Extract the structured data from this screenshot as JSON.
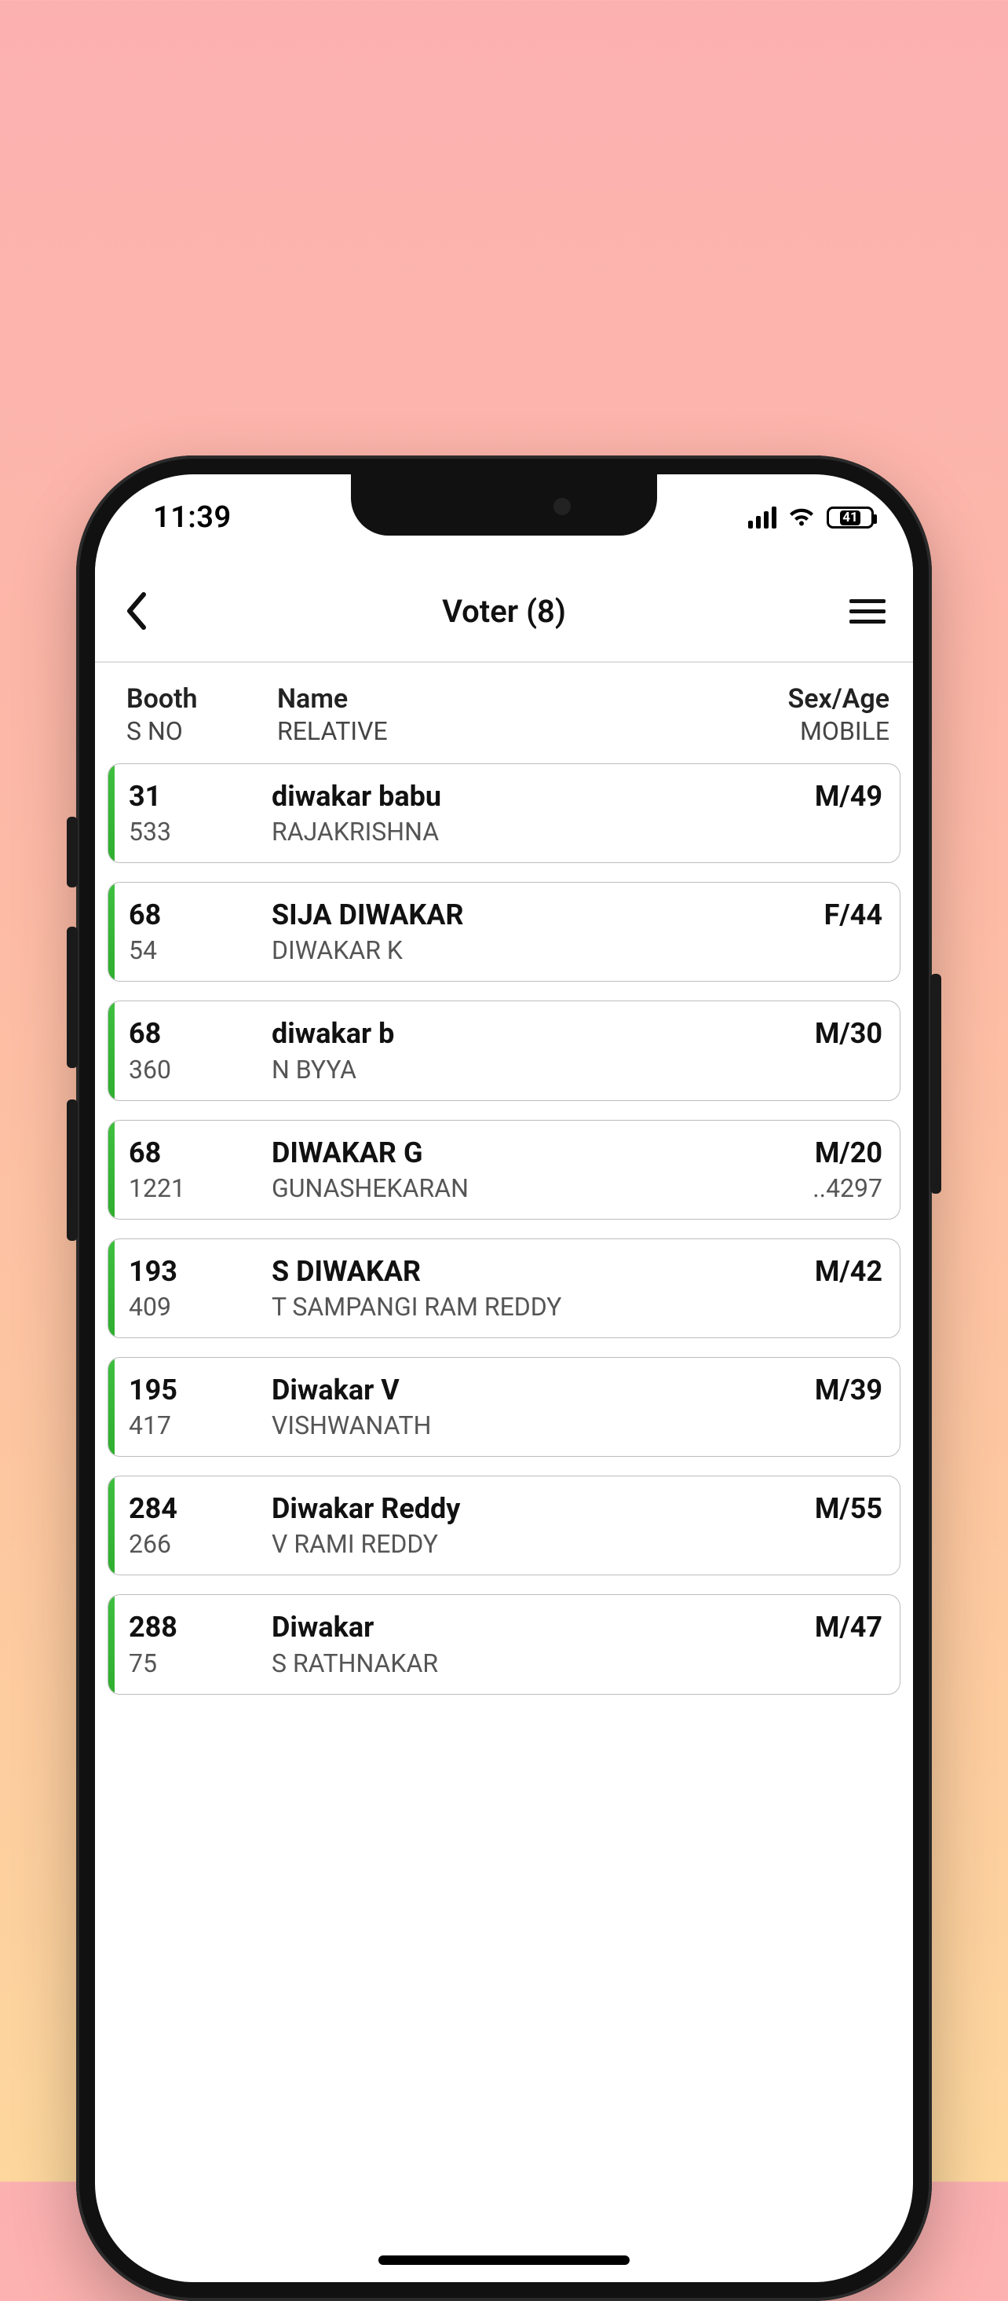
{
  "status": {
    "time": "11:39",
    "battery": "41"
  },
  "header": {
    "title": "Voter (8)"
  },
  "columns": {
    "booth_label": "Booth",
    "sno_label": "S NO",
    "name_label": "Name",
    "relative_label": "RELATIVE",
    "sex_age_label": "Sex/Age",
    "mobile_label": "MOBILE"
  },
  "rows": [
    {
      "booth": "31",
      "sno": "533",
      "name": "diwakar babu",
      "relative": "RAJAKRISHNA",
      "sex_age": "M/49",
      "mobile": ""
    },
    {
      "booth": "68",
      "sno": "54",
      "name": "SIJA DIWAKAR",
      "relative": "DIWAKAR K",
      "sex_age": "F/44",
      "mobile": ""
    },
    {
      "booth": "68",
      "sno": "360",
      "name": "diwakar b",
      "relative": "N BYYA",
      "sex_age": "M/30",
      "mobile": ""
    },
    {
      "booth": "68",
      "sno": "1221",
      "name": "DIWAKAR G",
      "relative": "GUNASHEKARAN",
      "sex_age": "M/20",
      "mobile": "..4297"
    },
    {
      "booth": "193",
      "sno": "409",
      "name": "S DIWAKAR",
      "relative": "T SAMPANGI RAM REDDY",
      "sex_age": "M/42",
      "mobile": ""
    },
    {
      "booth": "195",
      "sno": "417",
      "name": "Diwakar V",
      "relative": "VISHWANATH",
      "sex_age": "M/39",
      "mobile": ""
    },
    {
      "booth": "284",
      "sno": "266",
      "name": "Diwakar Reddy",
      "relative": "V RAMI REDDY",
      "sex_age": "M/55",
      "mobile": ""
    },
    {
      "booth": "288",
      "sno": "75",
      "name": "Diwakar",
      "relative": "S RATHNAKAR",
      "sex_age": "M/47",
      "mobile": ""
    }
  ]
}
